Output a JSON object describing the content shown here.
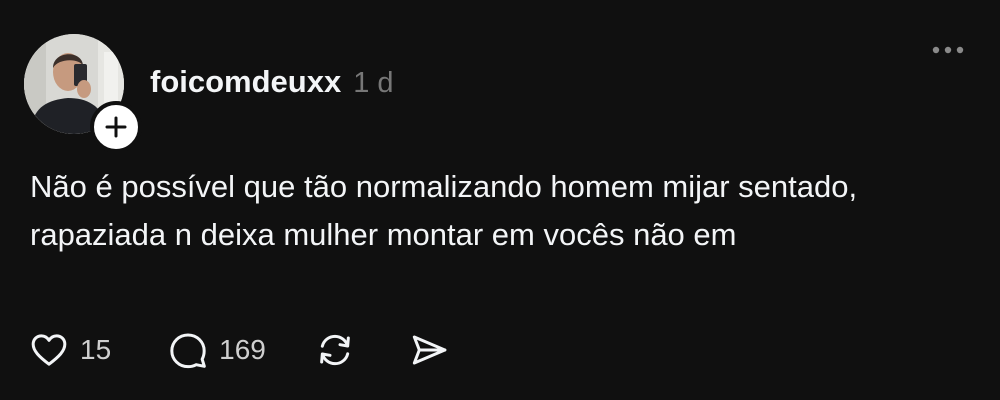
{
  "post": {
    "username": "foicomdeuxx",
    "timestamp": "1 d",
    "text": "Não é possível que tão normalizando homem mijar sentado, rapaziada n deixa mulher montar em vocês não em",
    "likes": "15",
    "replies": "169"
  },
  "icons": {
    "more": "more-horizontal-icon",
    "follow": "plus-icon",
    "like": "heart-icon",
    "reply": "comment-icon",
    "repost": "repost-icon",
    "share": "send-icon"
  },
  "colors": {
    "background": "#101010",
    "text": "#f3f5f7",
    "muted": "#777777"
  }
}
